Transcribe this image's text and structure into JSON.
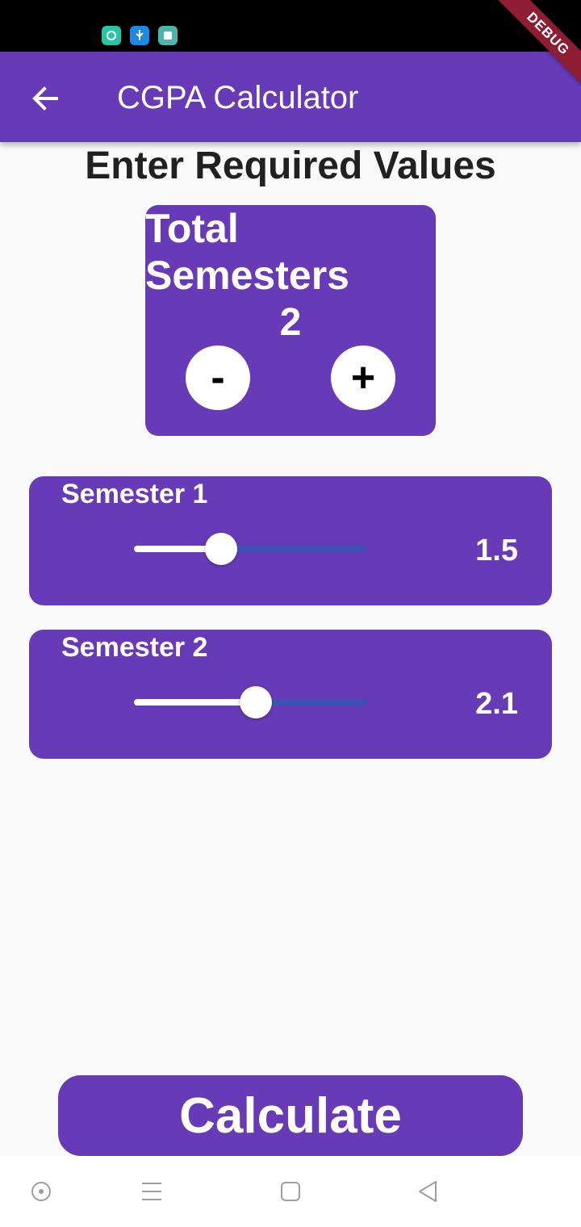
{
  "status_bar": {
    "icons": [
      "chat-bubble-icon",
      "usb-icon",
      "stacked-windows-icon"
    ]
  },
  "debug_banner": "DEBUG",
  "app_bar": {
    "title": "CGPA Calculator",
    "back_icon": "arrow-back-icon"
  },
  "heading": "Enter Required Values",
  "semesters_card": {
    "title": "Total Semesters",
    "value": "2",
    "minus_label": "-",
    "plus_label": "+"
  },
  "semesters": [
    {
      "label": "Semester 1",
      "value": "1.5",
      "slider_fraction": 0.375
    },
    {
      "label": "Semester 2",
      "value": "2.1",
      "slider_fraction": 0.525
    }
  ],
  "calculate_label": "Calculate",
  "nav_bar": {
    "icons": [
      "circle-dot-icon",
      "menu-lines-icon",
      "square-home-icon",
      "triangle-back-icon"
    ]
  },
  "colors": {
    "primary": "#673ab7",
    "slider_inactive": "#3f51b5",
    "background": "#fafafa",
    "debug": "#8e1d33"
  }
}
